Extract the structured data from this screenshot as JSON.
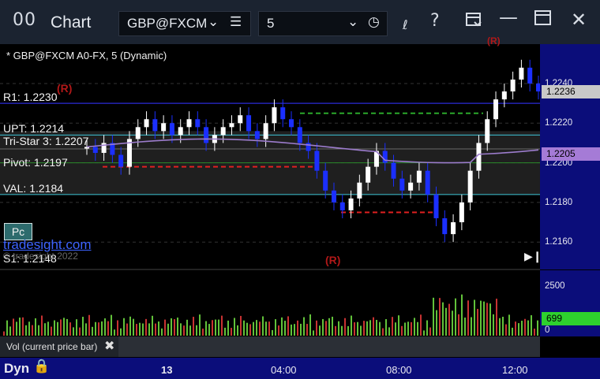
{
  "window": {
    "app_icon": "00",
    "title": "Chart",
    "symbol": "GBP@FXCM",
    "period": "5",
    "chart_title": "* GBP@FXCM A0-FX, 5 (Dynamic)"
  },
  "icons": {
    "symbol_chevron": "chevron-down-icon",
    "symbol_menu": "hamburger-menu-icon",
    "period_chevron": "chevron-down-icon",
    "period_clock": "clock-icon",
    "draw": "pen-icon",
    "help": "help-icon",
    "template": "template-icon",
    "minimize": "minimize-icon",
    "maximize": "maximize-icon",
    "close": "close-icon",
    "jump": "jump-to-end-icon",
    "lock": "lock-icon"
  },
  "levels": {
    "r1": "R1: 1.2230",
    "upt": "UPT: 1.2214",
    "tristar": "Tri-Star 3: 1.2207",
    "pivot": "Pivot: 1.2197",
    "val": "VAL: 1.2184",
    "s1": "S1: 1.2148"
  },
  "signals": {
    "r_top": "(R)",
    "r_mid": "(R)",
    "r_corner": "(R)"
  },
  "buttons": {
    "pc": "Pc"
  },
  "watermark": {
    "brand": "tradesight.com",
    "copyright": "© tradesight 2022"
  },
  "price_axis": {
    "ticks": [
      "1.2240",
      "1.2220",
      "1.2200",
      "1.2180",
      "1.2160"
    ],
    "current_price": "1.2236",
    "vwap_price": "1.2205"
  },
  "volume_axis": {
    "ticks": [
      "2500",
      "0"
    ],
    "current_volume": "699"
  },
  "volume_panel": {
    "label": "Vol (current price bar)"
  },
  "time_axis": {
    "mode": "Dyn",
    "ticks": [
      "13",
      "04:00",
      "08:00",
      "12:00"
    ]
  },
  "colors": {
    "bull": "#ffffff",
    "bear": "#1b2fff",
    "vwap": "#9c7ccc",
    "r1_line": "#2a2ad8",
    "val_line": "#3fc6d8",
    "green_dash": "#2aa82a",
    "red_dash": "#e02020",
    "axis_bg": "#0b0d7a",
    "current_price_bg": "#c8c8c8",
    "vwap_badge_bg": "#a57bd6"
  }
}
